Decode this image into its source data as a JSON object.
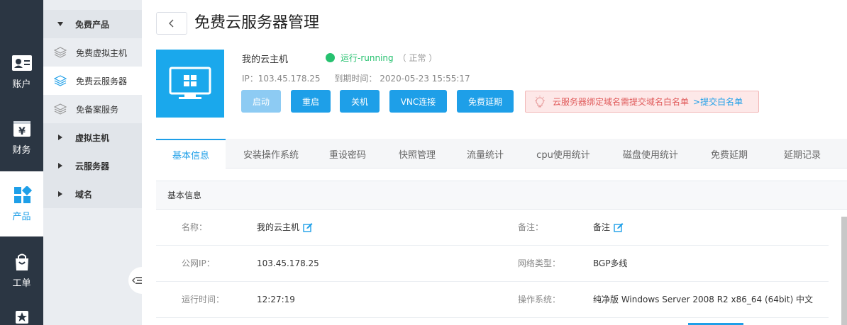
{
  "leftnav": {
    "items": [
      {
        "label": "账户",
        "icon": "id-card-icon"
      },
      {
        "label": "财务",
        "icon": "yen-box-icon"
      },
      {
        "label": "产品",
        "icon": "grid-squares-icon"
      },
      {
        "label": "工单",
        "icon": "bag-icon"
      },
      {
        "label": "",
        "icon": "star-icon"
      }
    ],
    "finance_glyph": "¥"
  },
  "subnav": {
    "free_group": "免费产品",
    "free_vhost": "免费虚拟主机",
    "free_cloud": "免费云服务器",
    "free_icp": "免备案服务",
    "vhost": "虚拟主机",
    "cloud": "云服务器",
    "domain": "域名"
  },
  "header": {
    "back": "<",
    "title": "免费云服务器管理"
  },
  "server": {
    "name": "我的云主机",
    "status": "运行-running",
    "status_note": "（ 正常 ）",
    "ip": "IP：103.45.178.25",
    "expire": "到期时间： 2020-05-23 15:55:17",
    "status_color": "#26c16f",
    "accent": "#1e9fe8"
  },
  "actions": {
    "start": "启动",
    "restart": "重启",
    "shutdown": "关机",
    "vnc": "VNC连接",
    "extend": "免费延期"
  },
  "notice": {
    "text": "云服务器绑定域名需提交域名白名单",
    "link": ">提交白名单"
  },
  "tabs": [
    "基本信息",
    "安装操作系统",
    "重设密码",
    "快照管理",
    "流量统计",
    "cpu使用统计",
    "磁盘使用统计",
    "免费延期",
    "延期记录"
  ],
  "info": {
    "title": "基本信息",
    "name_label": "名称：",
    "name_value": "我的云主机",
    "remark_label": "备注：",
    "remark_value": "备注",
    "ip_label": "公网IP：",
    "ip_value": "103.45.178.25",
    "net_label": "网络类型：",
    "net_value": "BGP多线",
    "uptime_label": "运行时间：",
    "uptime_value": "12:27:19",
    "os_label": "操作系统：",
    "os_value": "纯净版 Windows Server 2008 R2 x86_64 (64bit) 中文"
  }
}
